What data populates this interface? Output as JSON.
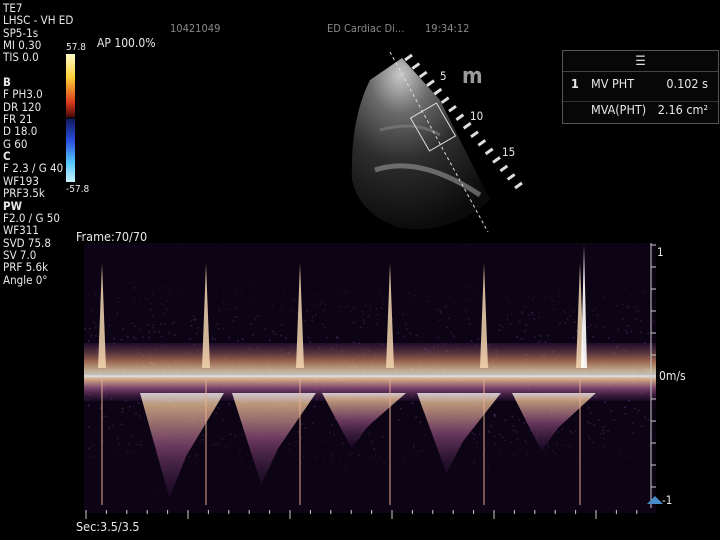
{
  "left_panel": {
    "lines": [
      "TE7",
      "LHSC - VH ED",
      "SP5-1s",
      "MI 0.30",
      "TIS 0.0",
      "",
      "B",
      "F PH3.0",
      "DR 120",
      "FR 21",
      "D 18.0",
      "G 60",
      "C",
      "F 2.3  / G 40",
      "WF193",
      "PRF3.5k",
      "PW",
      "F2.0  / G 50",
      "WF311",
      "SVD 75.8",
      "SV 7.0",
      "PRF 5.6k",
      "Angle    0°"
    ]
  },
  "color_scale": {
    "top": "57.8",
    "bottom": "-57.8"
  },
  "acoustic_power": "AP 100.0%",
  "header": {
    "patient_id": "10421049",
    "exam": "ED Cardiac Di...",
    "time": "19:34:12"
  },
  "measurements": {
    "menu_icon": "menu-icon",
    "index": "1",
    "rows": [
      {
        "label": "MV PHT",
        "value": "0.102 s"
      },
      {
        "label": "MVA(PHT)",
        "value": "2.16 cm²"
      }
    ]
  },
  "depth_labels": [
    "5",
    "10",
    "15"
  ],
  "logo_text": "m",
  "frame": "Frame:70/70",
  "sec": "Sec:3.5/3.5",
  "doppler_scale": {
    "top": "1",
    "zero": "0m/s",
    "bottom": "-1"
  },
  "colors": {
    "background": "#000000",
    "spectral": "#f2c890",
    "purple": "#6a3a90"
  }
}
